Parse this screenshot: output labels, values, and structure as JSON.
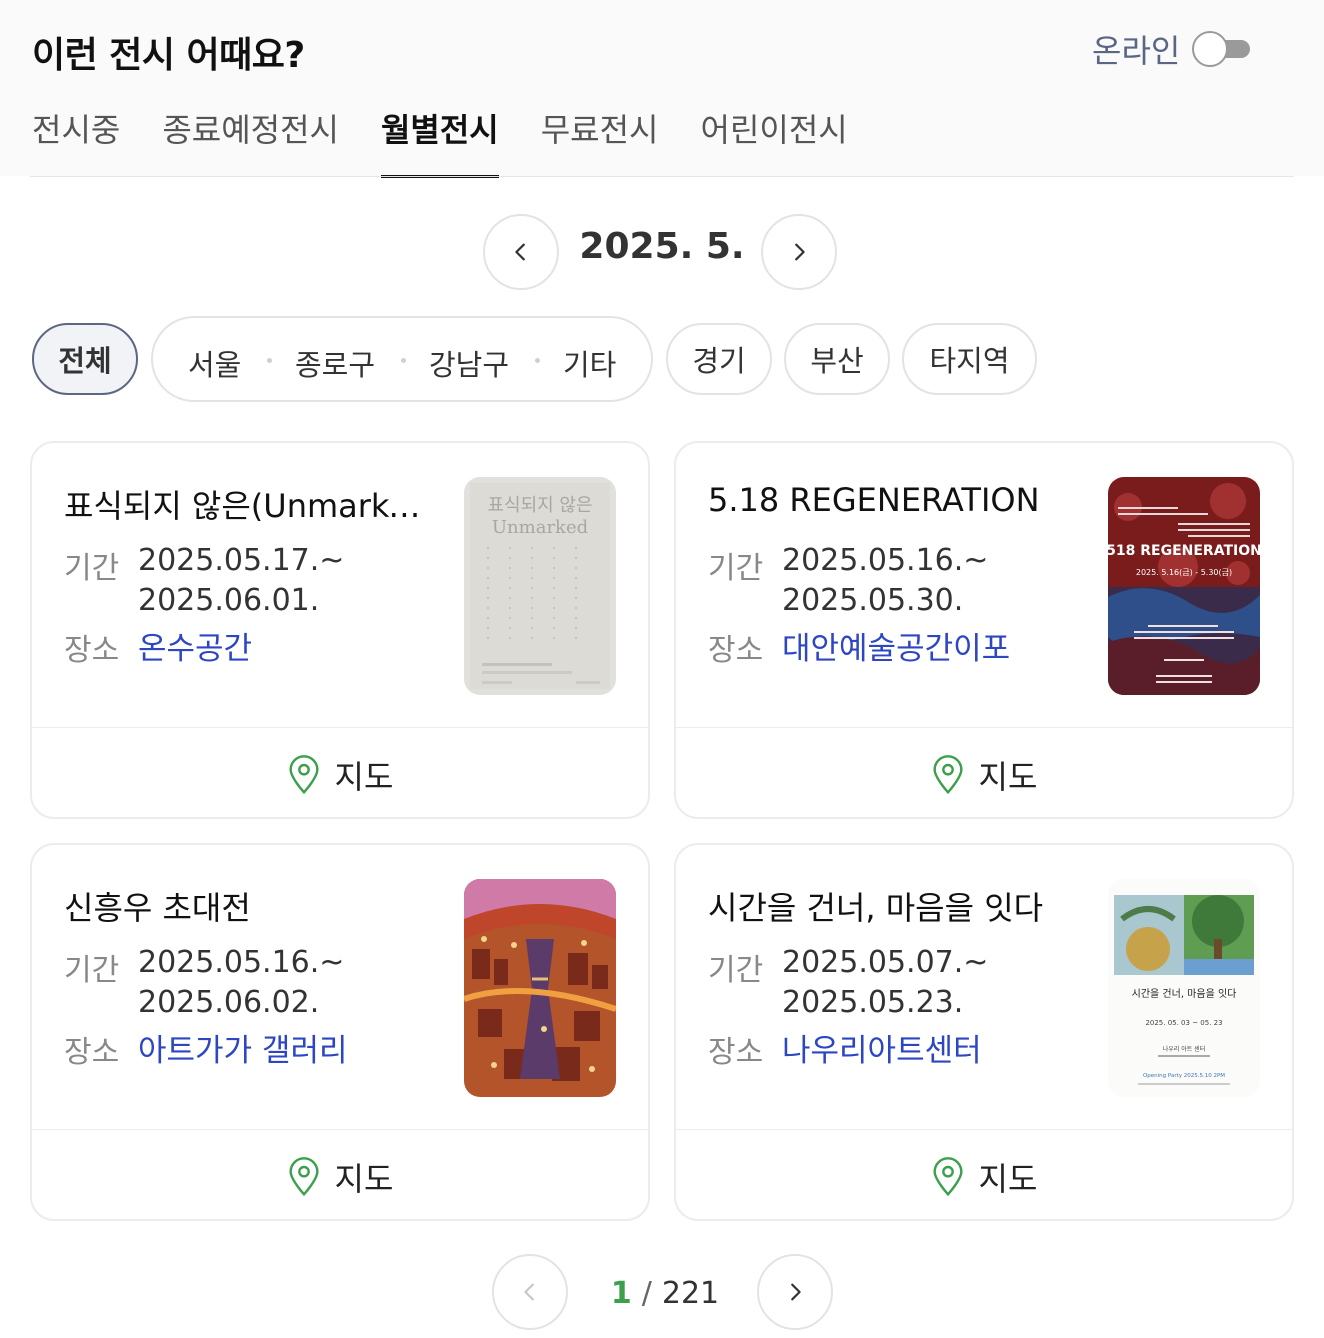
{
  "header": {
    "title": "이런 전시 어때요?",
    "online_label": "온라인"
  },
  "tabs": [
    {
      "label": "전시중"
    },
    {
      "label": "종료예정전시"
    },
    {
      "label": "월별전시"
    },
    {
      "label": "무료전시"
    },
    {
      "label": "어린이전시"
    }
  ],
  "active_tab": "월별전시",
  "month_nav": {
    "current": "2025. 5."
  },
  "regions": {
    "all": "전체",
    "seoul_group": [
      "서울",
      "종로구",
      "강남구",
      "기타"
    ],
    "others": [
      "경기",
      "부산",
      "타지역"
    ]
  },
  "labels": {
    "period": "기간",
    "place": "장소",
    "map": "지도"
  },
  "exhibitions": [
    {
      "title": "표식되지 않은(Unmarked)",
      "start": "2025.05.17.~",
      "end": "2025.06.01.",
      "venue": "온수공간",
      "poster_text": [
        "표식되지 않은",
        "Unmarked"
      ]
    },
    {
      "title": "5.18 REGENERATION",
      "start": "2025.05.16.~",
      "end": "2025.05.30.",
      "venue": "대안예술공간이포",
      "poster_text": [
        "518 REGENERATION",
        "2025. 5.16(금) - 5.30(금)"
      ]
    },
    {
      "title": "신흥우 초대전",
      "start": "2025.05.16.~",
      "end": "2025.06.02.",
      "venue": "아트가가 갤러리",
      "poster_text": []
    },
    {
      "title": "시간을 건너, 마음을 잇다",
      "start": "2025.05.07.~",
      "end": "2025.05.23.",
      "venue": "나우리아트센터",
      "poster_text": [
        "시간을 건너, 마음을 잇다",
        "2025. 05. 03  ~  05. 23",
        "나우리 아트 센터",
        "Opening Party 2025.5.10 2PM"
      ]
    }
  ],
  "pagination": {
    "current": "1",
    "separator": "/",
    "total": "221"
  },
  "colors": {
    "accent_link": "#2c46c4",
    "active_page": "#3c9f4b",
    "map_pin": "#3c9f4b",
    "chip_active_border": "#5d6683"
  }
}
